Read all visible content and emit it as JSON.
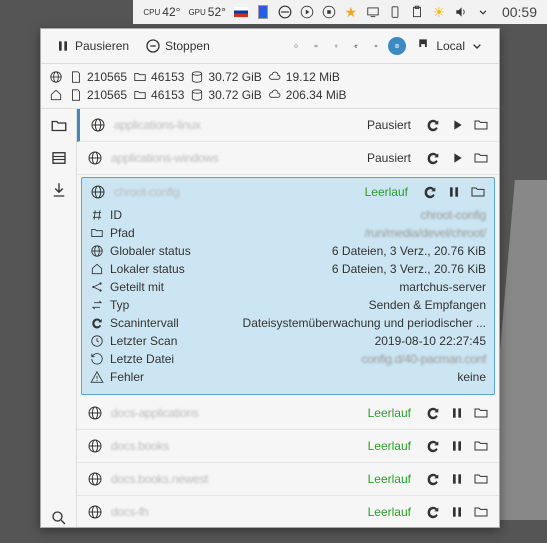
{
  "systray": {
    "cpu_label": "CPU",
    "cpu_temp": "42°",
    "gpu_label": "GPU",
    "gpu_temp": "52°",
    "clock": "00:59"
  },
  "toolbar": {
    "pause": "Pausieren",
    "stop": "Stoppen",
    "local": "Local"
  },
  "stats": {
    "global": {
      "files": "210565",
      "dirs": "46153",
      "size": "30.72 GiB",
      "cloud": "19.12 MiB"
    },
    "local": {
      "files": "210565",
      "dirs": "46153",
      "size": "30.72 GiB",
      "cloud": "206.34 MiB"
    }
  },
  "folders": [
    {
      "name": "applications-linux",
      "status": "Pausiert",
      "status_class": "",
      "paused": true
    },
    {
      "name": "applications-windows",
      "status": "Pausiert",
      "status_class": "",
      "paused": true
    },
    {
      "name": "chroot-config",
      "status": "Leerlauf",
      "status_class": "st-idle",
      "selected": true
    },
    {
      "name": "docs-applications",
      "status": "Leerlauf",
      "status_class": "st-idle"
    },
    {
      "name": "docs.books",
      "status": "Leerlauf",
      "status_class": "st-idle"
    },
    {
      "name": "docs.books.newest",
      "status": "Leerlauf",
      "status_class": "st-idle"
    },
    {
      "name": "docs-fh",
      "status": "Leerlauf",
      "status_class": "st-idle"
    }
  ],
  "details": {
    "id_label": "ID",
    "id_val": "chroot-config",
    "path_label": "Pfad",
    "path_val": "/run/media/devel/chroot/",
    "gstatus_label": "Globaler status",
    "gstatus_val": "6 Dateien, 3 Verz., 20.76 KiB",
    "lstatus_label": "Lokaler status",
    "lstatus_val": "6 Dateien, 3 Verz., 20.76 KiB",
    "shared_label": "Geteilt mit",
    "shared_val": "martchus-server",
    "type_label": "Typ",
    "type_val": "Senden & Empfangen",
    "scanint_label": "Scanintervall",
    "scanint_val": "Dateisystemüberwachung und periodischer ...",
    "lastscan_label": "Letzter Scan",
    "lastscan_val": "2019-08-10 22:27:45",
    "lastfile_label": "Letzte Datei",
    "lastfile_val": "config.d/40-pacman.conf",
    "errors_label": "Fehler",
    "errors_val": "keine"
  }
}
